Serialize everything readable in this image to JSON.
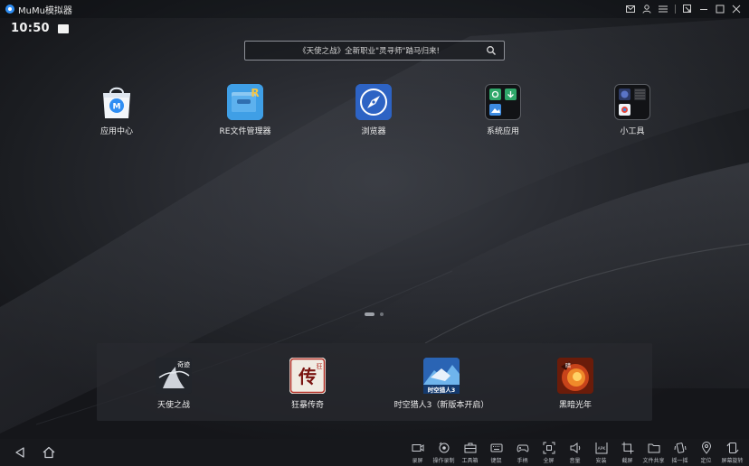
{
  "window": {
    "title": "MuMu模拟器",
    "controls": [
      "mail-icon",
      "user-icon",
      "menu-icon",
      "restore-icon",
      "minimize-icon",
      "maximize-icon",
      "close-icon"
    ]
  },
  "status": {
    "time": "10:50"
  },
  "search": {
    "text": "《天使之战》全新职业\"灵寻师\"踏马归来!"
  },
  "desktop": {
    "apps": [
      {
        "label": "应用中心",
        "icon": "app-center-icon"
      },
      {
        "label": "RE文件管理器",
        "icon": "re-file-manager-icon"
      },
      {
        "label": "浏览器",
        "icon": "browser-compass-icon"
      },
      {
        "label": "系统应用",
        "icon": "system-apps-folder-icon"
      },
      {
        "label": "小工具",
        "icon": "tools-folder-icon"
      }
    ]
  },
  "pager": {
    "pages": 2,
    "current": 1
  },
  "dock": {
    "apps": [
      {
        "label": "天使之战",
        "icon": "tianshi-zhizhan-icon"
      },
      {
        "label": "狂暴传奇",
        "icon": "kuangbao-chuanqi-icon"
      },
      {
        "label": "时空猎人3（新版本开启）",
        "icon": "shikong-lieren3-icon"
      },
      {
        "label": "黑暗光年",
        "icon": "heian-guangnian-icon"
      }
    ]
  },
  "toolbar": {
    "tools": [
      {
        "label": "录屏",
        "icon": "record-screen-icon"
      },
      {
        "label": "操作录制",
        "icon": "macro-record-icon"
      },
      {
        "label": "工具箱",
        "icon": "toolbox-icon"
      },
      {
        "label": "键鼠",
        "icon": "keyboard-icon"
      },
      {
        "label": "手柄",
        "icon": "gamepad-icon"
      },
      {
        "label": "全屏",
        "icon": "fullscreen-icon"
      },
      {
        "label": "音量",
        "icon": "volume-icon"
      },
      {
        "label": "安装",
        "icon": "apk-install-icon"
      },
      {
        "label": "截屏",
        "icon": "screenshot-icon"
      },
      {
        "label": "文件共享",
        "icon": "file-share-icon"
      },
      {
        "label": "摇一摇",
        "icon": "shake-icon"
      },
      {
        "label": "定位",
        "icon": "location-icon"
      },
      {
        "label": "屏幕旋转",
        "icon": "rotate-screen-icon"
      }
    ]
  },
  "colors": {
    "accent": "#2f8ef3",
    "background": "#1b1d21",
    "dock": "#2a2c31"
  }
}
